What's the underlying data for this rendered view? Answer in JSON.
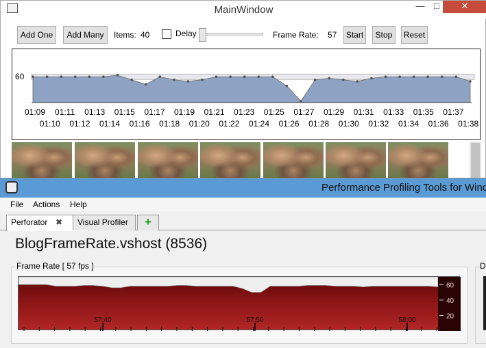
{
  "main_window": {
    "title": "MainWindow",
    "controls": {
      "add_one": "Add One",
      "add_many": "Add Many",
      "items_label": "Items:",
      "items_value": "40",
      "delay_label": "Delay",
      "frame_rate_label": "Frame Rate:",
      "frame_rate_value": "57",
      "start": "Start",
      "stop": "Stop",
      "reset": "Reset"
    },
    "graph": {
      "y_label": "60",
      "ticks_top": [
        "01:09",
        "01:11",
        "01:13",
        "01:15",
        "01:17",
        "01:19",
        "01:21",
        "01:23",
        "01:25",
        "01:27",
        "01:29",
        "01:31",
        "01:33",
        "01:35",
        "01:37"
      ],
      "ticks_bottom": [
        "01:10",
        "01:12",
        "01:14",
        "01:16",
        "01:18",
        "01:20",
        "01:22",
        "01:24",
        "01:26",
        "01:28",
        "01:30",
        "01:32",
        "01:34",
        "01:36",
        "01:38"
      ],
      "values": [
        60,
        60,
        60,
        60,
        60,
        60,
        61,
        58,
        55,
        60,
        58,
        57,
        58,
        60,
        60,
        60,
        60,
        60,
        54,
        44,
        58,
        59,
        58,
        57,
        59,
        60,
        60,
        60,
        60,
        60,
        60,
        57
      ],
      "fill_color": "#8ea3c3"
    }
  },
  "profiler": {
    "title": "Performance Profiling Tools for Wind",
    "menu": [
      "File",
      "Actions",
      "Help"
    ],
    "tabs": [
      {
        "label": "Perforator",
        "active": true
      },
      {
        "label": "Visual Profiler",
        "active": false
      }
    ],
    "add_tab": "+",
    "process": "BlogFrameRate.vshost (8536)",
    "frame_rate_title": "Frame Rate [ 57 fps ]",
    "right_panel_label": "D",
    "chart": {
      "y_ticks": [
        "60",
        "40",
        "20"
      ],
      "x_ticks": [
        "57:40",
        "57:50",
        "58:00"
      ],
      "values": [
        60,
        60,
        60,
        60,
        58,
        58,
        58,
        59,
        59,
        58,
        56,
        56,
        58,
        58,
        58,
        58,
        58,
        59,
        59,
        58,
        58,
        58,
        58,
        58,
        55,
        50,
        50,
        58,
        58,
        58,
        58,
        59,
        59,
        59,
        58,
        58,
        58,
        57,
        58,
        58,
        58,
        58,
        58,
        58,
        58,
        57
      ],
      "background": "#8a1414"
    }
  }
}
